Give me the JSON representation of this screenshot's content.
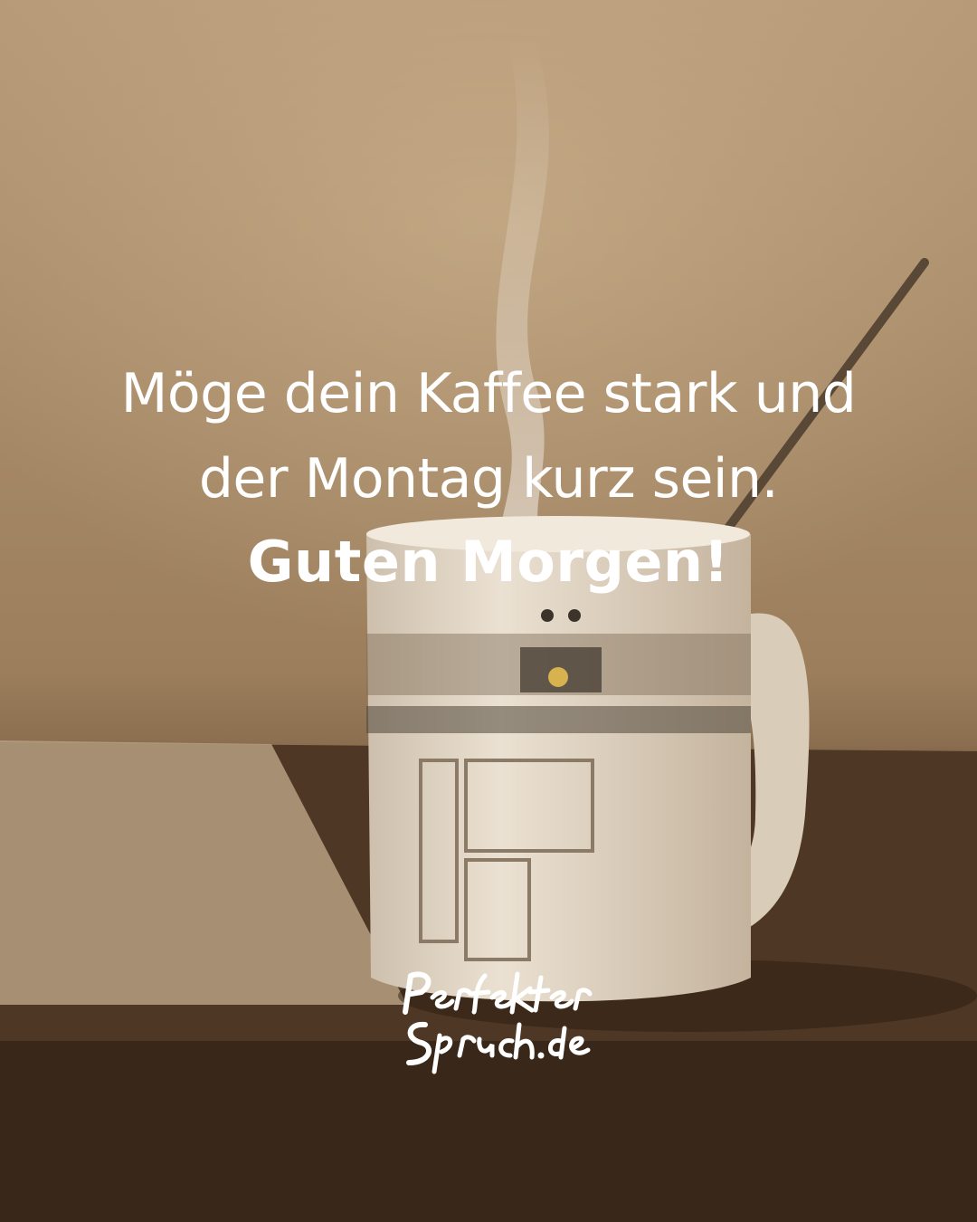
{
  "quote": {
    "line1": "Möge dein Kaffee stark und",
    "line2": "der Montag kurz sein.",
    "greeting": "Guten Morgen!"
  },
  "brand": {
    "logo_text": "Perfekter Spruch.de"
  },
  "colors": {
    "text": "#ffffff",
    "wall": "#b79a78",
    "table": "#4b3523",
    "mug": "#e8dccb"
  }
}
